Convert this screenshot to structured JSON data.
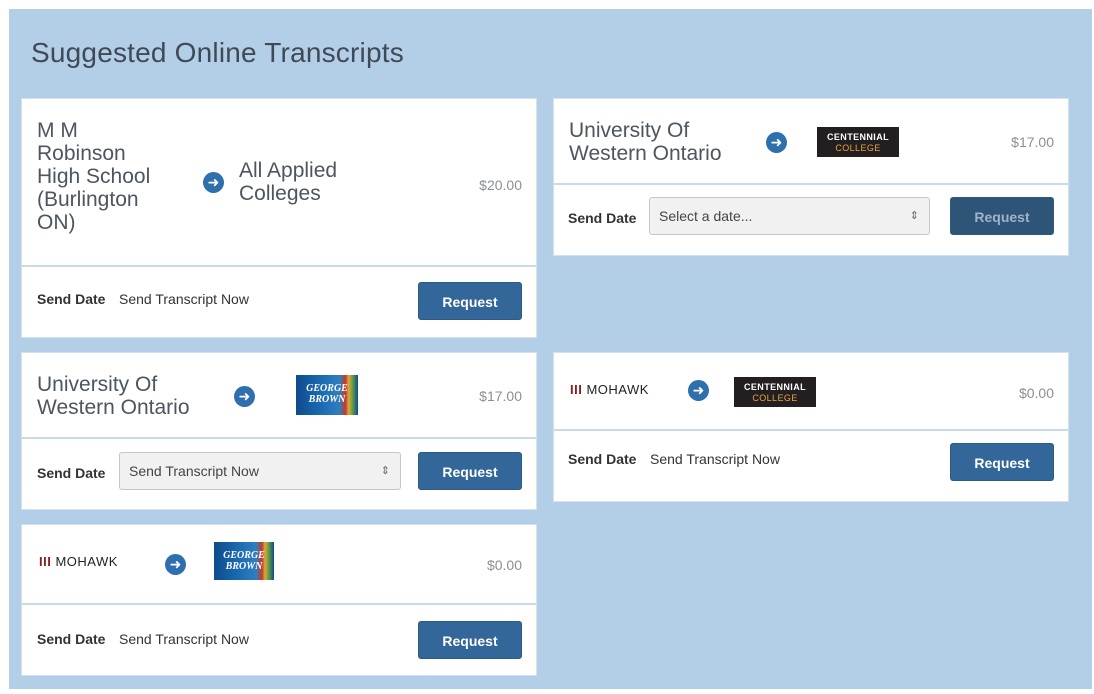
{
  "page": {
    "title": "Suggested Online Transcripts"
  },
  "cards": [
    {
      "from": "M M Robinson High School (Burlington ON)",
      "to": "All Applied Colleges",
      "price": "$20.00",
      "send_label": "Send Date",
      "send_value": "Send Transcript Now",
      "button": "Request"
    },
    {
      "from": "University Of Western Ontario",
      "to_logo": "CENTENNIAL COLLEGE",
      "price": "$17.00",
      "send_label": "Send Date",
      "select_value": "Select a date...",
      "button": "Request"
    },
    {
      "from": "University Of Western Ontario",
      "to_logo": "GEORGE BROWN",
      "price": "$17.00",
      "send_label": "Send Date",
      "select_value": "Send Transcript Now",
      "button": "Request"
    },
    {
      "from_logo": "MOHAWK",
      "to_logo": "CENTENNIAL COLLEGE",
      "price": "$0.00",
      "send_label": "Send Date",
      "send_value": "Send Transcript Now",
      "button": "Request"
    },
    {
      "from_logo": "MOHAWK",
      "to_logo": "GEORGE BROWN",
      "price": "$0.00",
      "send_label": "Send Date",
      "send_value": "Send Transcript Now",
      "button": "Request"
    }
  ],
  "logos": {
    "centennial_line1": "CENTENNIAL",
    "centennial_line2": "COLLEGE",
    "georgebrown_line1": "GEORGE",
    "georgebrown_line2": "BROWN",
    "mohawk_bars": "III",
    "mohawk_word": "MOHAWK"
  },
  "icons": {
    "arrow": "arrow-right-circle-icon",
    "caret": "select-caret-icon"
  },
  "colors": {
    "panel": "#b3cfe8",
    "button": "#336699",
    "arrow": "#2e6fad"
  }
}
